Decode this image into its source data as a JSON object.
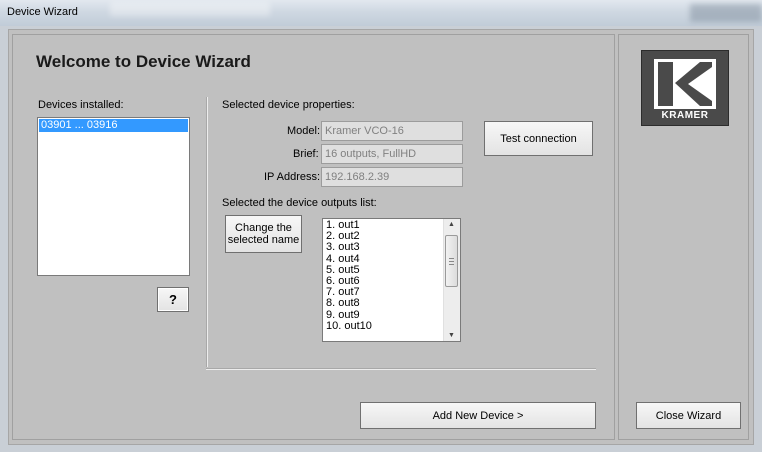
{
  "window": {
    "title": "Device Wizard"
  },
  "heading": "Welcome to Device Wizard",
  "devices": {
    "label": "Devices installed:",
    "items": [
      "03901 ... 03916"
    ],
    "help_button": "?"
  },
  "properties": {
    "label": "Selected device properties:",
    "model_label": "Model:",
    "model_value": "Kramer VCO-16",
    "brief_label": "Brief:",
    "brief_value": "16 outputs, FullHD",
    "ip_label": "IP Address:",
    "ip_value": "192.168.2.39",
    "test_button": "Test connection"
  },
  "outputs": {
    "label": "Selected the device outputs list:",
    "change_button_line1": "Change the",
    "change_button_line2": "selected name",
    "items": [
      "1.  out1",
      "2.  out2",
      "3.  out3",
      "4.  out4",
      "5.  out5",
      "6.  out6",
      "7.  out7",
      "8.  out8",
      "9.  out9",
      "10.  out10"
    ]
  },
  "footer": {
    "add_button": "Add New Device >",
    "close_button": "Close Wizard"
  },
  "logo": {
    "text": "KRAMER"
  },
  "colors": {
    "selection": "#3399ff",
    "logo_bg": "#4a4a4a"
  }
}
